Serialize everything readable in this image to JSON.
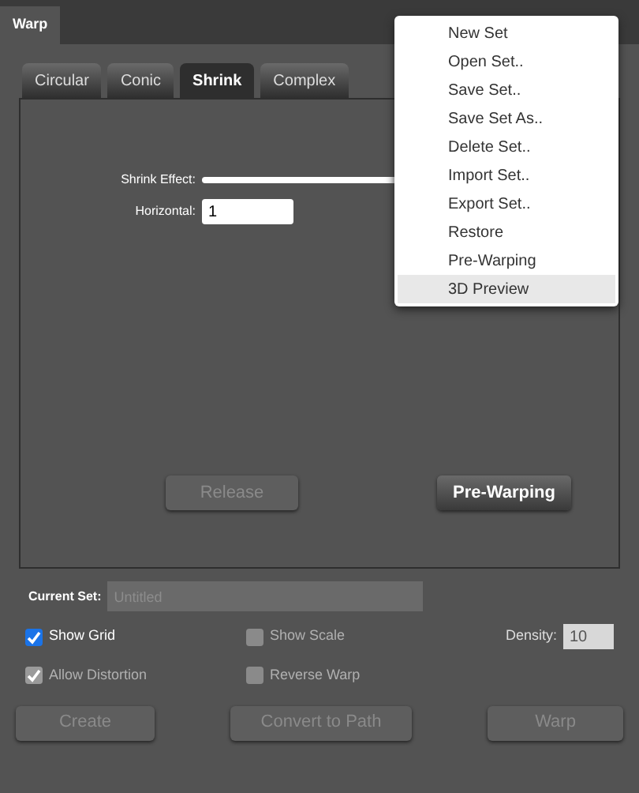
{
  "panel": {
    "title": "Warp"
  },
  "tabs": [
    {
      "label": "Circular",
      "selected": false
    },
    {
      "label": "Conic",
      "selected": false
    },
    {
      "label": "Shrink",
      "selected": true
    },
    {
      "label": "Complex",
      "selected": false
    }
  ],
  "shrink_effect": {
    "label": "Shrink Effect:"
  },
  "horizontal": {
    "label": "Horizontal:",
    "value": "1"
  },
  "inner_buttons": [
    {
      "label": "Release",
      "disabled": true
    },
    {
      "label": "Pre-Warping",
      "disabled": false
    }
  ],
  "current_set": {
    "label": "Current Set:",
    "placeholder": "Untitled"
  },
  "options": [
    {
      "label": "Show Grid",
      "checked": true,
      "disabled": false
    },
    {
      "label": "Show Scale",
      "checked": false,
      "disabled": true
    },
    {
      "label": "Allow Distortion",
      "checked": true,
      "disabled": true
    },
    {
      "label": "Reverse Warp",
      "checked": false,
      "disabled": true
    }
  ],
  "density": {
    "label": "Density:",
    "value": "10"
  },
  "buttons": [
    {
      "label": "Create",
      "disabled": true
    },
    {
      "label": "Convert to Path",
      "disabled": true
    },
    {
      "label": "Warp",
      "disabled": true
    }
  ],
  "menu": [
    {
      "label": "New Set",
      "selected": false
    },
    {
      "label": "Open Set..",
      "selected": false
    },
    {
      "label": "Save Set..",
      "selected": false
    },
    {
      "label": "Save Set As..",
      "selected": false
    },
    {
      "label": "Delete Set..",
      "selected": false
    },
    {
      "label": "Import Set..",
      "selected": false
    },
    {
      "label": "Export Set..",
      "selected": false
    },
    {
      "label": "Restore",
      "selected": false
    },
    {
      "label": "Pre-Warping",
      "selected": false
    },
    {
      "label": "3D Preview",
      "selected": true
    }
  ]
}
